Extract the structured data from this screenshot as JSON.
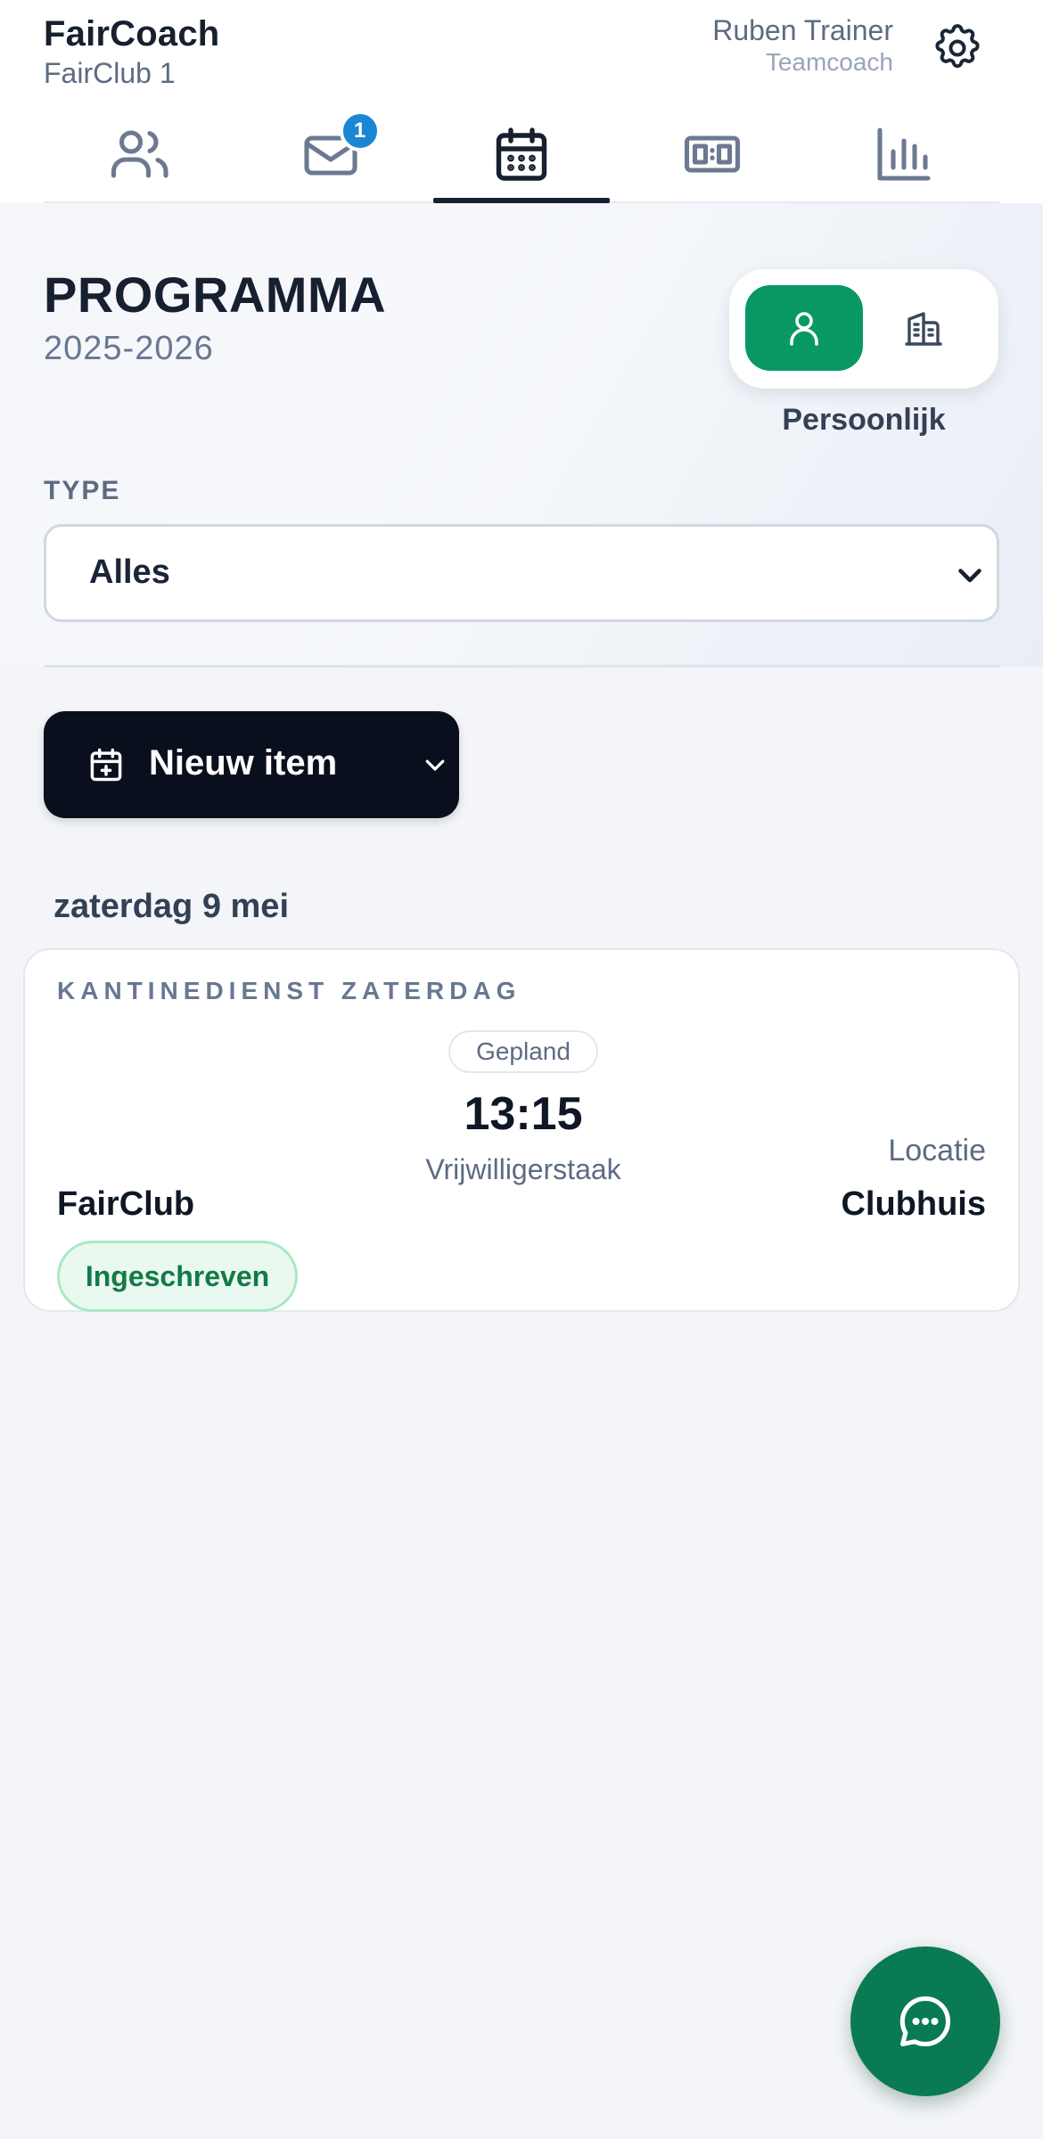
{
  "header": {
    "app_name": "FairCoach",
    "club_name": "FairClub 1",
    "user_name": "Ruben Trainer",
    "user_role": "Teamcoach"
  },
  "tabs": [
    {
      "icon": "team-icon",
      "active": false
    },
    {
      "icon": "mail-icon",
      "active": false,
      "badge": "1"
    },
    {
      "icon": "calendar-icon",
      "active": true
    },
    {
      "icon": "scoreboard-icon",
      "active": false
    },
    {
      "icon": "stats-icon",
      "active": false
    }
  ],
  "page": {
    "title": "PROGRAMMA",
    "season": "2025-2026"
  },
  "view_toggle": {
    "options": [
      {
        "icon": "person-icon",
        "selected": true
      },
      {
        "icon": "building-icon",
        "selected": false
      }
    ],
    "label": "Persoonlijk"
  },
  "filter": {
    "label": "TYPE",
    "value": "Alles"
  },
  "new_item": {
    "label": "Nieuw item"
  },
  "schedule": {
    "day_heading": "zaterdag 9 mei",
    "items": [
      {
        "type": "KANTINEDIENST ZATERDAG",
        "status": "Gepland",
        "time": "13:15",
        "subtitle": "Vrijwilligerstaak",
        "team": "FairClub",
        "location_label": "Locatie",
        "location": "Clubhuis",
        "enrollment": "Ingeschreven"
      }
    ]
  },
  "colors": {
    "accent_green": "#089863",
    "fab_green": "#0a7a52",
    "badge_blue": "#1a86d4",
    "dark": "#0a0f1d"
  }
}
